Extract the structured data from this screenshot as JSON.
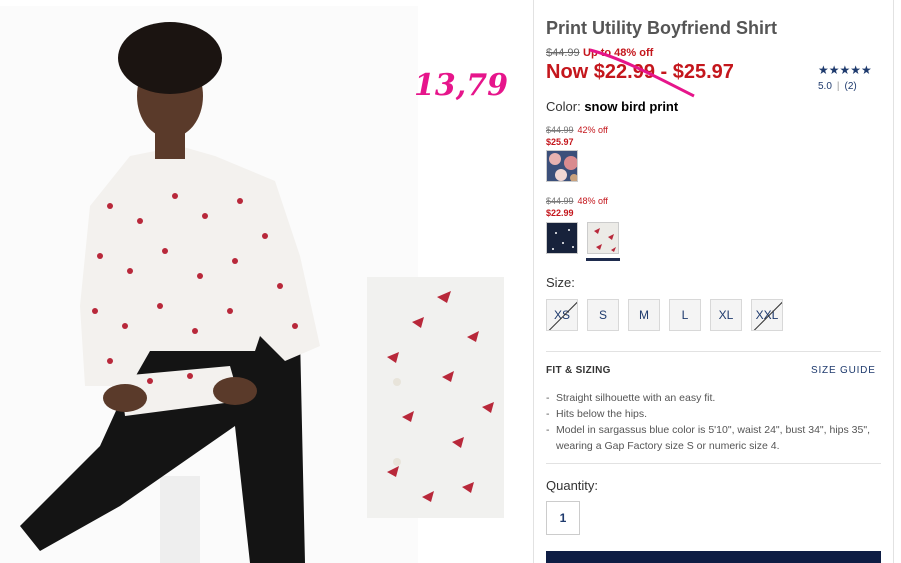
{
  "annotation": {
    "handwritten_price": "13,79",
    "color": "#e6158b"
  },
  "product": {
    "title": "Print Utility Boyfriend Shirt",
    "original_price": "$44.99",
    "discount_text": "Up to 48% off",
    "now_price": "Now $22.99 - $25.97",
    "rating": {
      "stars": "★★★★★",
      "score": "5.0",
      "reviews": "(2)"
    },
    "color_label": "Color:",
    "color_value": "snow bird print"
  },
  "variants": [
    {
      "old_price": "$44.99",
      "discount": "42% off",
      "new_price": "$25.97",
      "swatch": "floral-print"
    },
    {
      "old_price": "$44.99",
      "discount": "48% off",
      "new_price": "$22.99",
      "swatches": [
        "navy-star-print",
        "snow-bird-print"
      ],
      "selected": "snow-bird-print"
    }
  ],
  "sizes": {
    "label": "Size:",
    "options": [
      {
        "label": "XS",
        "available": false
      },
      {
        "label": "S",
        "available": true
      },
      {
        "label": "M",
        "available": true
      },
      {
        "label": "L",
        "available": true
      },
      {
        "label": "XL",
        "available": true
      },
      {
        "label": "XXL",
        "available": false
      }
    ]
  },
  "fit": {
    "title": "FIT & SIZING",
    "size_guide": "SIZE GUIDE",
    "bullets": [
      "Straight silhouette with an easy fit.",
      "Hits below the hips.",
      "Model in sargassus blue color is 5'10\", waist 24\", bust 34\", hips 35\", wearing a Gap Factory size S or numeric size 4."
    ]
  },
  "quantity": {
    "label": "Quantity:",
    "value": "1"
  },
  "colors": {
    "sale_red": "#c4161c",
    "navy": "#1e3a6d",
    "button_navy": "#0e1d44"
  }
}
